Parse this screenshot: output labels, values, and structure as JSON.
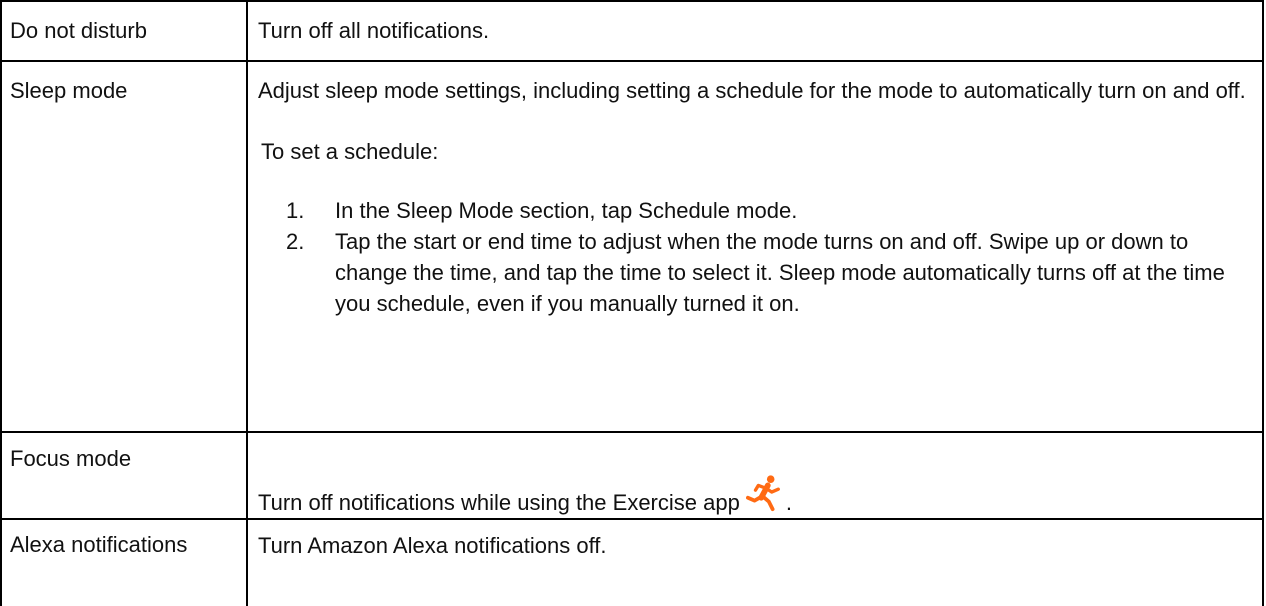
{
  "rows": [
    {
      "name": "Do not disturb",
      "description": "Turn off all notifications."
    },
    {
      "name": "Sleep mode",
      "description": "Adjust sleep mode settings, including setting a schedule for the mode to automatically turn on and off.",
      "sub_heading": "To set a schedule:",
      "steps": [
        {
          "number": "1.",
          "text": "In the Sleep Mode section, tap Schedule mode."
        },
        {
          "number": "2.",
          "text": "Tap the start or end time to adjust when the mode turns on and off. Swipe up or down to change the time, and tap the time to select it. Sleep mode automatically turns off at the time you schedule, even if you manually turned it on."
        }
      ]
    },
    {
      "name": "Focus mode",
      "description": "Turn off notifications while using the Exercise app",
      "trailing": ".",
      "icon": "exercise-runner-icon",
      "icon_color": "#ff6a13"
    },
    {
      "name": "Alexa notifications",
      "description": "Turn Amazon Alexa notifications off."
    }
  ]
}
